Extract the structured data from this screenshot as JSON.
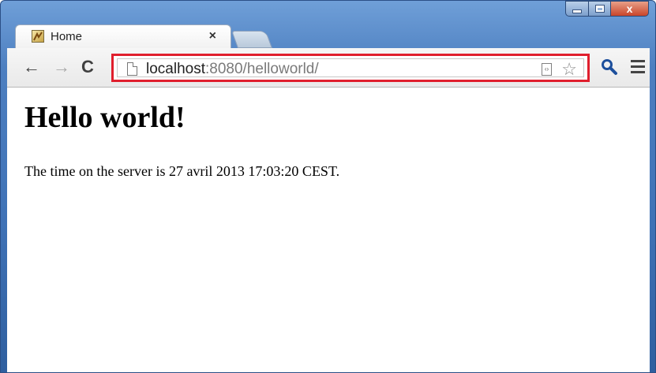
{
  "browser": {
    "tab": {
      "title": "Home",
      "close_label": "×"
    },
    "window_controls": {
      "close_label": "x"
    },
    "toolbar": {
      "back_label": "←",
      "forward_label": "→",
      "reload_label": "C",
      "url_host": "localhost",
      "url_rest": ":8080/helloworld/",
      "highlight_color": "#e01f2d",
      "star_label": "☆"
    }
  },
  "page": {
    "heading": "Hello world!",
    "server_time_text": "The time on the server is 27 avril 2013 17:03:20 CEST."
  }
}
